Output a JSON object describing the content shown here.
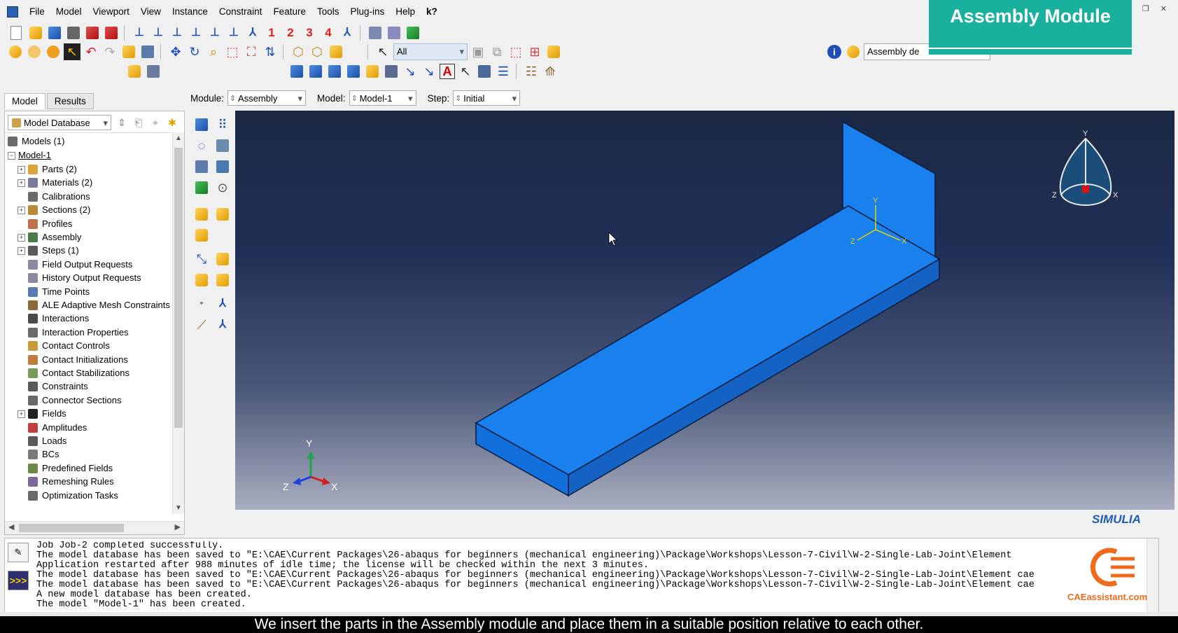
{
  "menu": [
    "File",
    "Model",
    "Viewport",
    "View",
    "Instance",
    "Constraint",
    "Feature",
    "Tools",
    "Plug-ins",
    "Help",
    "k?"
  ],
  "banner": "Assembly Module",
  "toolbar": {
    "selection_filter": "All",
    "assembly_display": "Assembly de",
    "view_numbers": [
      "1",
      "2",
      "3",
      "4"
    ]
  },
  "tabs": [
    "Model",
    "Results"
  ],
  "database_select": "Model Database",
  "tree": {
    "root": "Models (1)",
    "model": "Model-1",
    "items": [
      {
        "label": "Parts (2)",
        "expand": true,
        "color": "#d9a53a"
      },
      {
        "label": "Materials (2)",
        "expand": true,
        "color": "#7a7a9a"
      },
      {
        "label": "Calibrations",
        "expand": false,
        "color": "#6a6a6a"
      },
      {
        "label": "Sections (2)",
        "expand": true,
        "color": "#b98a3a"
      },
      {
        "label": "Profiles",
        "expand": false,
        "color": "#c0704a"
      },
      {
        "label": "Assembly",
        "expand": true,
        "color": "#4a7a4a"
      },
      {
        "label": "Steps (1)",
        "expand": true,
        "color": "#5a5a5a"
      },
      {
        "label": "Field Output Requests",
        "expand": false,
        "color": "#8a8aa0"
      },
      {
        "label": "History Output Requests",
        "expand": false,
        "color": "#8a8aa0"
      },
      {
        "label": "Time Points",
        "expand": false,
        "color": "#5a7ab0"
      },
      {
        "label": "ALE Adaptive Mesh Constraints",
        "expand": false,
        "color": "#8a6a3a"
      },
      {
        "label": "Interactions",
        "expand": false,
        "color": "#4a4a4a"
      },
      {
        "label": "Interaction Properties",
        "expand": false,
        "color": "#6a6a6a"
      },
      {
        "label": "Contact Controls",
        "expand": false,
        "color": "#c99a3a"
      },
      {
        "label": "Contact Initializations",
        "expand": false,
        "color": "#c07a3a"
      },
      {
        "label": "Contact Stabilizations",
        "expand": false,
        "color": "#7a9a5a"
      },
      {
        "label": "Constraints",
        "expand": false,
        "color": "#5a5a5a"
      },
      {
        "label": "Connector Sections",
        "expand": false,
        "color": "#6a6a6a"
      },
      {
        "label": "Fields",
        "expand": true,
        "color": "#222222"
      },
      {
        "label": "Amplitudes",
        "expand": false,
        "color": "#c04040"
      },
      {
        "label": "Loads",
        "expand": false,
        "color": "#5a5a5a"
      },
      {
        "label": "BCs",
        "expand": false,
        "color": "#7a7a7a"
      },
      {
        "label": "Predefined Fields",
        "expand": false,
        "color": "#6a8a4a"
      },
      {
        "label": "Remeshing Rules",
        "expand": false,
        "color": "#7a6a9a"
      },
      {
        "label": "Optimization Tasks",
        "expand": false,
        "color": "#6a6a6a"
      }
    ]
  },
  "context": {
    "module_label": "Module:",
    "module_value": "Assembly",
    "model_label": "Model:",
    "model_value": "Model-1",
    "step_label": "Step:",
    "step_value": "Initial"
  },
  "viewport": {
    "triad_main": {
      "x": "X",
      "y": "Y",
      "z": "Z"
    },
    "triad_local": {
      "x": "X",
      "y": "Y",
      "z": "Z"
    },
    "compass": {
      "x": "X",
      "y": "Y",
      "z": "Z"
    },
    "brand": "SIMULIA"
  },
  "messages": [
    "Job Job-2 completed successfully.",
    "The model database has been saved to \"E:\\CAE\\Current Packages\\26-abaqus for beginners (mechanical engineering)\\Package\\Workshops\\Lesson-7-Civil\\W-2-Single-Lab-Joint\\Element",
    "Application restarted after 988 minutes of idle time; the license will be checked within the next 3 minutes.",
    "The model database has been saved to \"E:\\CAE\\Current Packages\\26-abaqus for beginners (mechanical engineering)\\Package\\Workshops\\Lesson-7-Civil\\W-2-Single-Lab-Joint\\Element cae",
    "The model database has been saved to \"E:\\CAE\\Current Packages\\26-abaqus for beginners (mechanical engineering)\\Package\\Workshops\\Lesson-7-Civil\\W-2-Single-Lab-Joint\\Element cae",
    "A new model database has been created.",
    "The model \"Model-1\" has been created."
  ],
  "python_btn": ">>>",
  "logo_text": "CAEassistant.com",
  "caption": "We insert the parts in the Assembly module and place them in a suitable position relative to each other.",
  "colors": {
    "part_top": "#1a80ee",
    "part_side": "#1462c4",
    "part_end": "#1170dc",
    "banner": "#19b09d",
    "logo": "#f06a1c"
  }
}
